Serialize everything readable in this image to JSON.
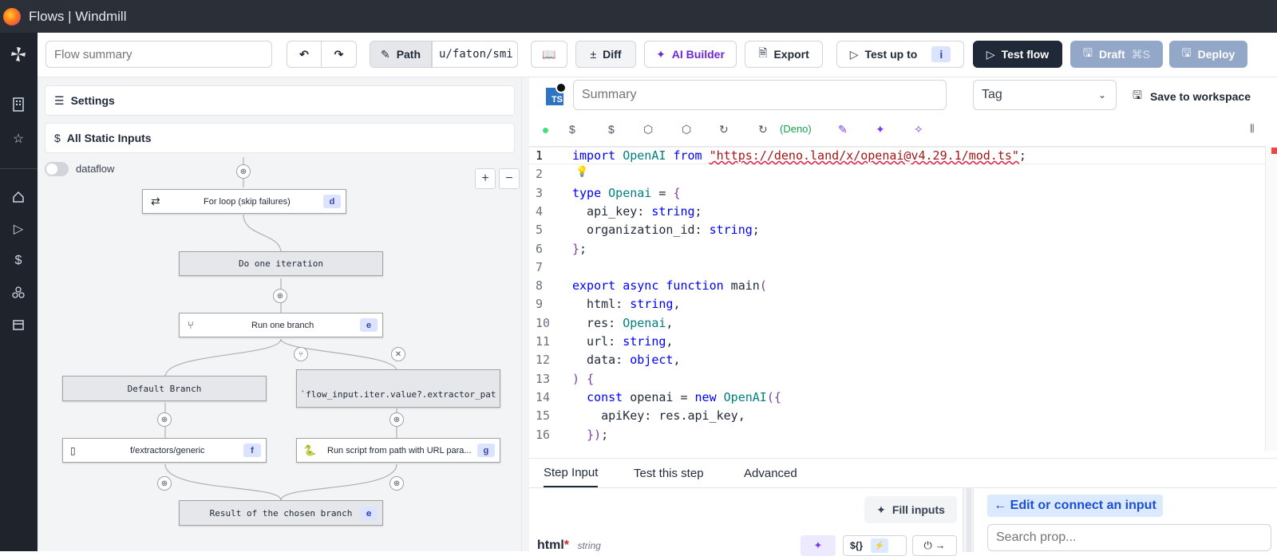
{
  "window": {
    "title": "Flows | Windmill"
  },
  "toolbar": {
    "summary_placeholder": "Flow summary",
    "path_label": "Path",
    "path_value": "u/faton/smi",
    "diff_label": "Diff",
    "ai_builder_label": "AI Builder",
    "export_label": "Export",
    "test_up_to_label": "Test up to",
    "test_up_to_badge": "i",
    "test_flow_label": "Test flow",
    "draft_label": "Draft",
    "draft_shortcut": "⌘S",
    "deploy_label": "Deploy"
  },
  "flow": {
    "settings_label": "Settings",
    "static_inputs_label": "All Static Inputs",
    "dataflow_label": "dataflow",
    "nodes": [
      {
        "label": "For loop (skip failures)",
        "badge": "d"
      },
      {
        "label": "Do one iteration"
      },
      {
        "label": "Run one branch",
        "badge": "e"
      },
      {
        "label": "Default Branch"
      },
      {
        "label": "`flow_input.iter.value?.extractor_pat"
      },
      {
        "label": "f/extractors/generic",
        "badge": "f"
      },
      {
        "label": "Run script from path with URL para...",
        "badge": "g"
      },
      {
        "label": "Result of the chosen branch",
        "badge": "e"
      }
    ]
  },
  "editor": {
    "lang_badge": "TS",
    "summary_placeholder": "Summary",
    "tag_placeholder": "Tag",
    "save_to_workspace_label": "Save to workspace",
    "deno_label": "(Deno)",
    "lines": [
      {
        "n": "1",
        "text": "import OpenAI from \"https://deno.land/x/openai@v4.29.1/mod.ts\";"
      },
      {
        "n": "2",
        "text": ""
      },
      {
        "n": "3",
        "text": "type Openai = {"
      },
      {
        "n": "4",
        "text": "  api_key: string;"
      },
      {
        "n": "5",
        "text": "  organization_id: string;"
      },
      {
        "n": "6",
        "text": "};"
      },
      {
        "n": "7",
        "text": ""
      },
      {
        "n": "8",
        "text": "export async function main("
      },
      {
        "n": "9",
        "text": "  html: string,"
      },
      {
        "n": "10",
        "text": "  res: Openai,"
      },
      {
        "n": "11",
        "text": "  url: string,"
      },
      {
        "n": "12",
        "text": "  data: object,"
      },
      {
        "n": "13",
        "text": ") {"
      },
      {
        "n": "14",
        "text": "  const openai = new OpenAI({"
      },
      {
        "n": "15",
        "text": "    apiKey: res.api_key,"
      },
      {
        "n": "16",
        "text": "  });"
      }
    ]
  },
  "bottom": {
    "tabs": [
      "Step Input",
      "Test this step",
      "Advanced"
    ],
    "fill_inputs_label": "Fill inputs",
    "edit_connect_label": "← Edit or connect an input",
    "search_placeholder": "Search prop...",
    "field_name": "html",
    "field_required": "*",
    "field_type": "string",
    "mode_badge": "${}"
  },
  "colors": {
    "accent": "#3b82f6",
    "dark_button": "#1f2937",
    "draft": "#93a8c9",
    "badge": "#dbe4ff"
  }
}
